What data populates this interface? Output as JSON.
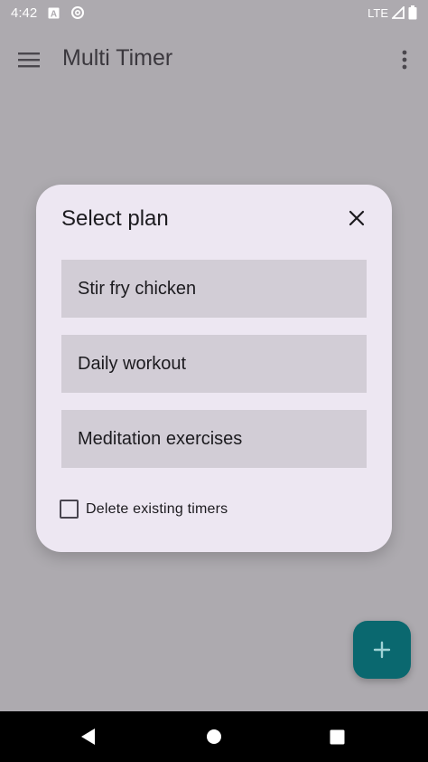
{
  "status_bar": {
    "time": "4:42",
    "network": "LTE",
    "icons": [
      "text-a-icon",
      "sync-icon",
      "signal-icon",
      "battery-icon"
    ]
  },
  "app_bar": {
    "title": "Multi Timer",
    "icons": [
      "menu-icon",
      "more-vert-icon"
    ]
  },
  "dialog": {
    "title": "Select plan",
    "close_icon": "close-icon",
    "plans": [
      {
        "label": "Stir fry chicken"
      },
      {
        "label": "Daily workout"
      },
      {
        "label": "Meditation exercises"
      }
    ],
    "delete_existing": {
      "label": "Delete existing timers",
      "checked": false
    }
  },
  "fab": {
    "icon": "plus-icon"
  },
  "nav_bar": {
    "icons": [
      "back-icon",
      "home-icon",
      "recents-icon"
    ]
  },
  "colors": {
    "scrim_background": "#adaaaf",
    "dialog_surface": "#ede7f2",
    "plan_item": "#d2cdd6",
    "fab": "#0a686f",
    "nav_bar": "#000000"
  }
}
